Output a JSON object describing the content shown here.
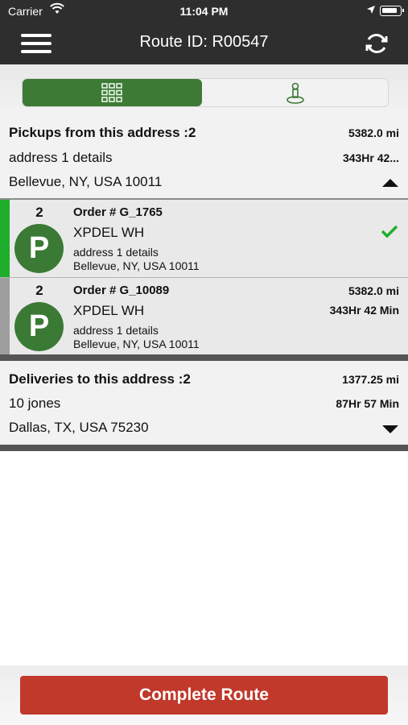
{
  "status_bar": {
    "carrier": "Carrier",
    "time": "11:04 PM"
  },
  "header": {
    "title": "Route ID: R00547"
  },
  "pickups": {
    "title": "Pickups from this address :2",
    "distance": "5382.0 mi",
    "address_line": "address 1 details",
    "duration": "343Hr 42...",
    "city_line": "Bellevue, NY, USA 10011",
    "orders": [
      {
        "count": "2",
        "badge": "P",
        "order_no": "Order # G_1765",
        "name": "XPDEL WH",
        "addr1": "address 1 details",
        "addr2": "Bellevue, NY, USA 10011",
        "distance": "",
        "duration": "",
        "stripe_color": "#1fae2b"
      },
      {
        "count": "2",
        "badge": "P",
        "order_no": "Order # G_10089",
        "name": "XPDEL WH",
        "addr1": "address 1 details",
        "addr2": "Bellevue, NY, USA 10011",
        "distance": "5382.0 mi",
        "duration": "343Hr 42 Min",
        "stripe_color": "#9e9e9e"
      }
    ]
  },
  "deliveries": {
    "title": "Deliveries to this address :2",
    "distance": "1377.25 mi",
    "address_line": "10 jones",
    "duration": "87Hr 57 Min",
    "city_line": "Dallas, TX, USA 75230"
  },
  "footer": {
    "complete_label": "Complete Route"
  },
  "colors": {
    "accent_green": "#3a7a35",
    "complete_red": "#c0392b",
    "header_bg": "#2e2e2e",
    "check_green": "#1fae2b"
  },
  "icons": [
    "wifi-icon",
    "location-arrow-icon",
    "battery-icon",
    "menu-icon",
    "refresh-icon",
    "grid-icon",
    "map-pin-icon",
    "checkmark-icon",
    "chevron-up-icon",
    "chevron-down-icon"
  ]
}
